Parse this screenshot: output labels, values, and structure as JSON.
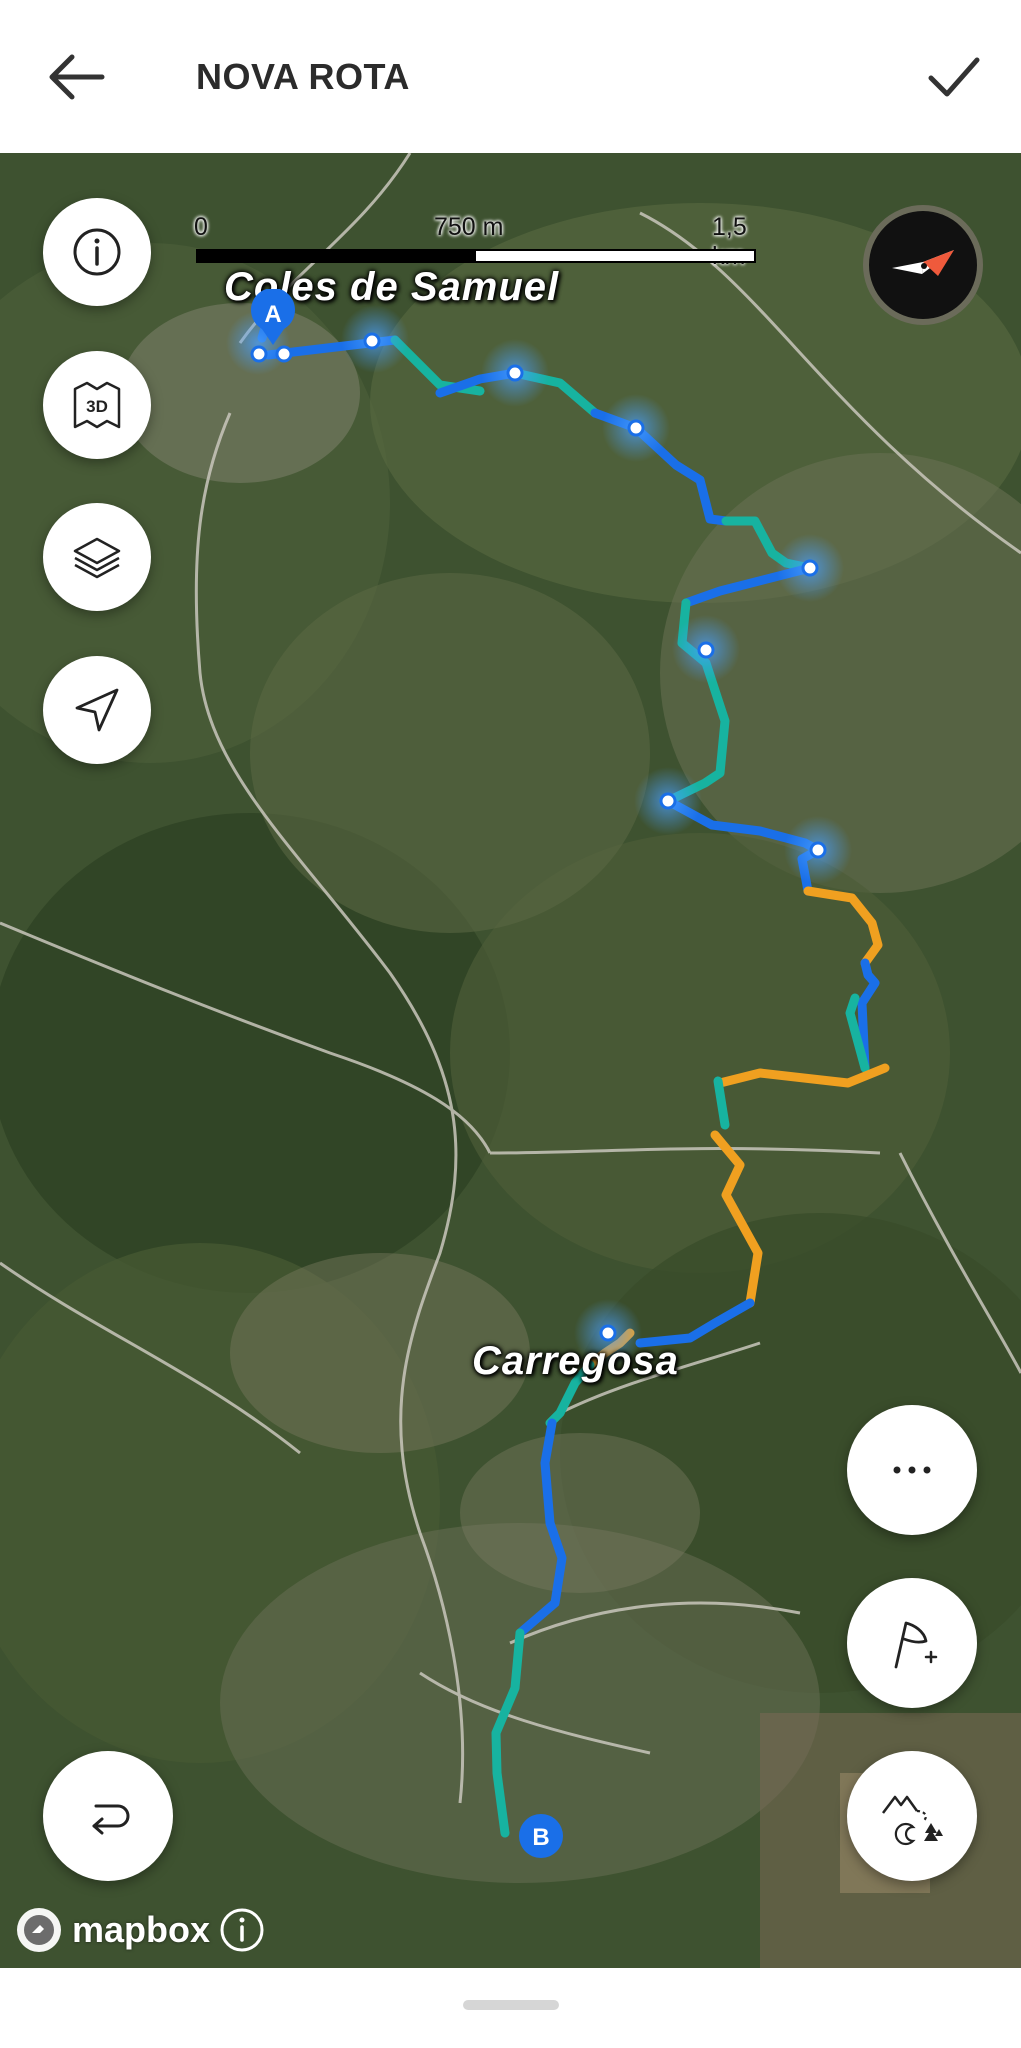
{
  "header": {
    "title": "NOVA ROTA"
  },
  "map": {
    "scale_labels": [
      "0",
      "750 m",
      "1,5 km"
    ],
    "places": [
      "Coles de Samuel",
      "Carregosa"
    ],
    "markers": {
      "start": "A",
      "end": "B"
    },
    "route_colors": {
      "blue": "#1a6fe8",
      "teal": "#17b3a0",
      "orange": "#f0a020"
    },
    "attribution": "mapbox"
  },
  "left_controls": [
    {
      "name": "info-button",
      "icon": "info-icon"
    },
    {
      "name": "3d-button",
      "icon": "3d-map-icon",
      "label": "3D"
    },
    {
      "name": "layers-button",
      "icon": "layers-icon"
    },
    {
      "name": "locate-button",
      "icon": "navigation-arrow-icon"
    }
  ],
  "right_controls": [
    {
      "name": "more-button",
      "icon": "ellipsis-icon"
    },
    {
      "name": "add-waypoint-button",
      "icon": "flag-plus-icon"
    },
    {
      "name": "trail-type-button",
      "icon": "mountain-trail-icon"
    }
  ],
  "reverse_button": {
    "icon": "reverse-route-icon"
  }
}
